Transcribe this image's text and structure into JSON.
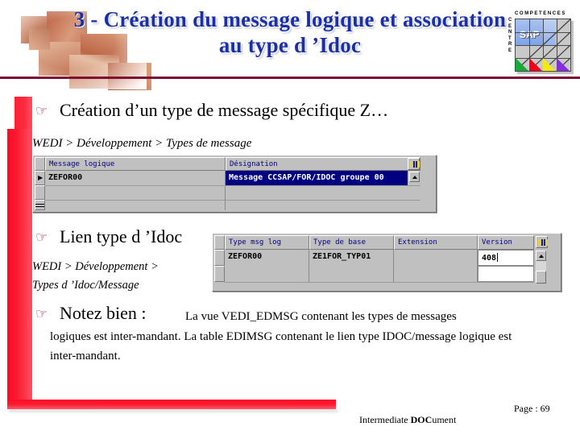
{
  "slide": {
    "title": "3 - Création du message logique et association au type d ’Idoc",
    "title_color": "#1b2fa8"
  },
  "logo": {
    "header_text": "COMPETENCES",
    "side_text": "CENTRE",
    "brand": "SAP"
  },
  "bullets": {
    "bullet_glyph": "☞",
    "one": {
      "text": "Création d’un type de message spécifique Z…",
      "path": "WEDI > Développement > Types de message"
    },
    "two": {
      "text": "Lien type d ’Idoc",
      "path_line1": "WEDI > Développement >",
      "path_line2": "Types d ’Idoc/Message"
    },
    "three": {
      "lead": "Notez bien :",
      "rest": "La vue VEDI_EDMSG contenant les types de messages",
      "body": "logiques est inter-mandant. La table EDIMSG contenant le lien type IDOC/message logique est inter-mandant."
    }
  },
  "table_message": {
    "columns": [
      "Message logique",
      "Désignation"
    ],
    "rows": [
      {
        "cells": [
          "ZEFOR00",
          "Message CCSAP/FOR/IDOC groupe 00"
        ],
        "selected_cell": 1,
        "marker": "▶"
      },
      {
        "cells": [
          "",
          ""
        ],
        "selected_cell": -1,
        "marker": ""
      }
    ]
  },
  "table_link": {
    "columns": [
      "Type msg log",
      "Type de base",
      "Extension",
      "Version"
    ],
    "rows": [
      {
        "cells": [
          "ZEFOR00",
          "ZE1FOR_TYP01",
          "",
          "408"
        ],
        "editing_cell": 3,
        "marker": ""
      },
      {
        "cells": [
          "",
          "",
          "",
          ""
        ],
        "editing_cell": -1,
        "marker": ""
      }
    ]
  },
  "footer": {
    "doc_prefix": "Inter",
    "doc_mid": "mediate ",
    "doc_bold": "DOC",
    "doc_suffix": "ument",
    "page_label": "Page : 69"
  }
}
